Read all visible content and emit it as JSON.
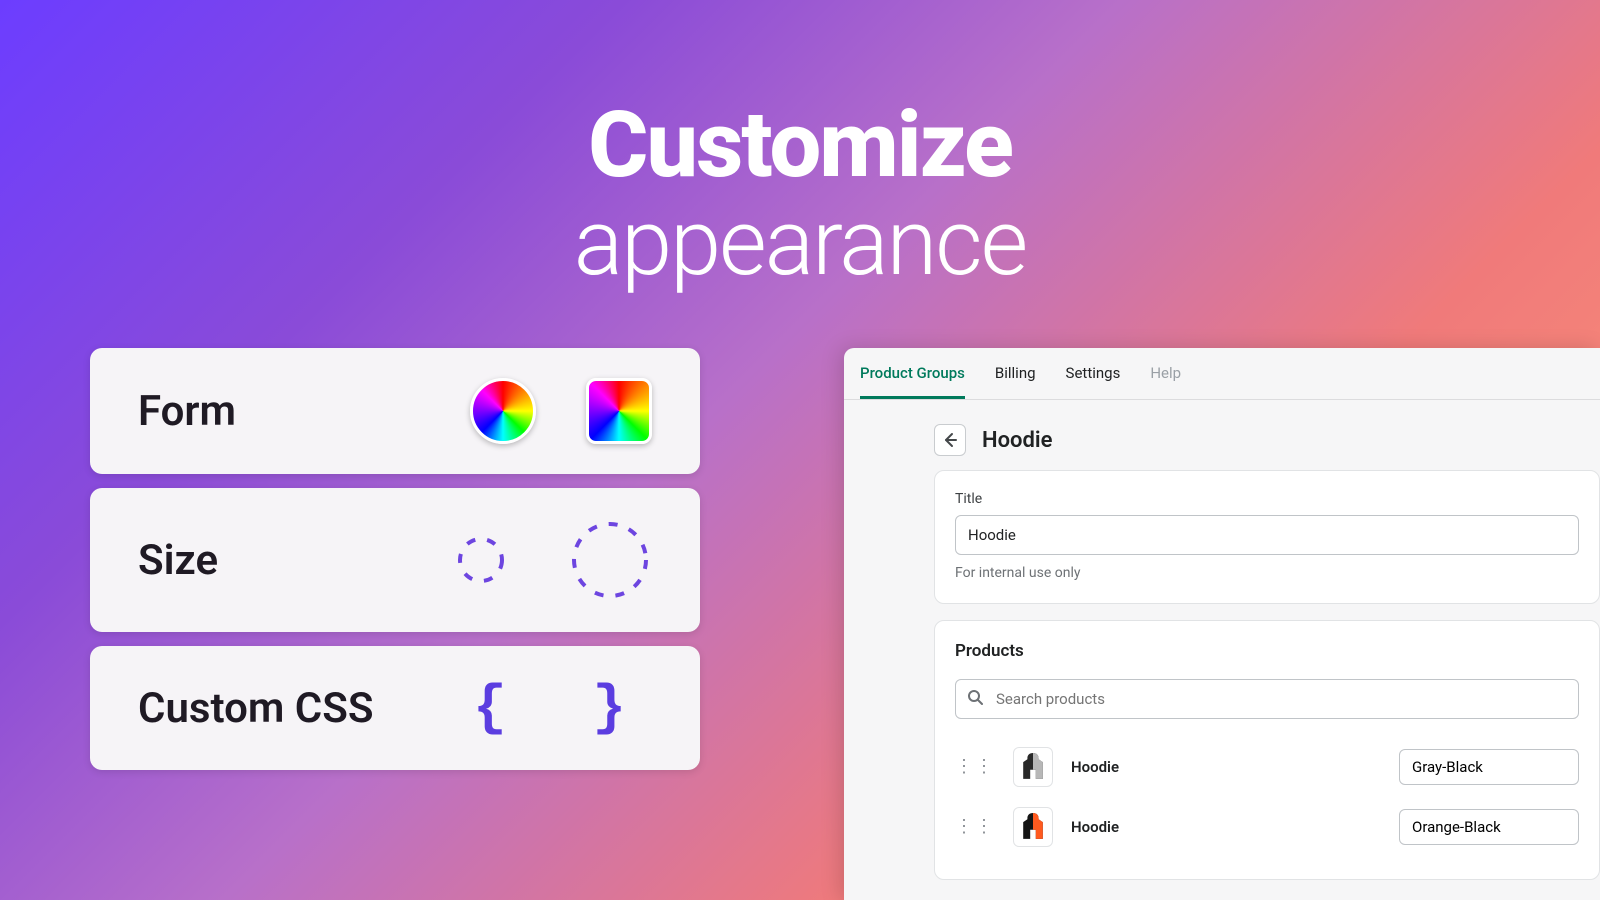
{
  "hero": {
    "title": "Customize",
    "subtitle": "appearance"
  },
  "cards": {
    "form": {
      "label": "Form"
    },
    "size": {
      "label": "Size"
    },
    "css": {
      "label": "Custom CSS",
      "braces": "{ }"
    }
  },
  "panel": {
    "tabs": [
      {
        "label": "Product Groups",
        "active": true
      },
      {
        "label": "Billing"
      },
      {
        "label": "Settings"
      },
      {
        "label": "Help",
        "dim": true
      }
    ],
    "page_title": "Hoodie",
    "title_box": {
      "label": "Title",
      "value": "Hoodie",
      "hint": "For internal use only"
    },
    "products_box": {
      "heading": "Products",
      "search_placeholder": "Search products",
      "rows": [
        {
          "name": "Hoodie",
          "variant": "Gray-Black",
          "swatch": [
            "#282828",
            "#b7b7b7"
          ]
        },
        {
          "name": "Hoodie",
          "variant": "Orange-Black",
          "swatch": [
            "#141414",
            "#ff5a1f"
          ]
        }
      ]
    }
  }
}
